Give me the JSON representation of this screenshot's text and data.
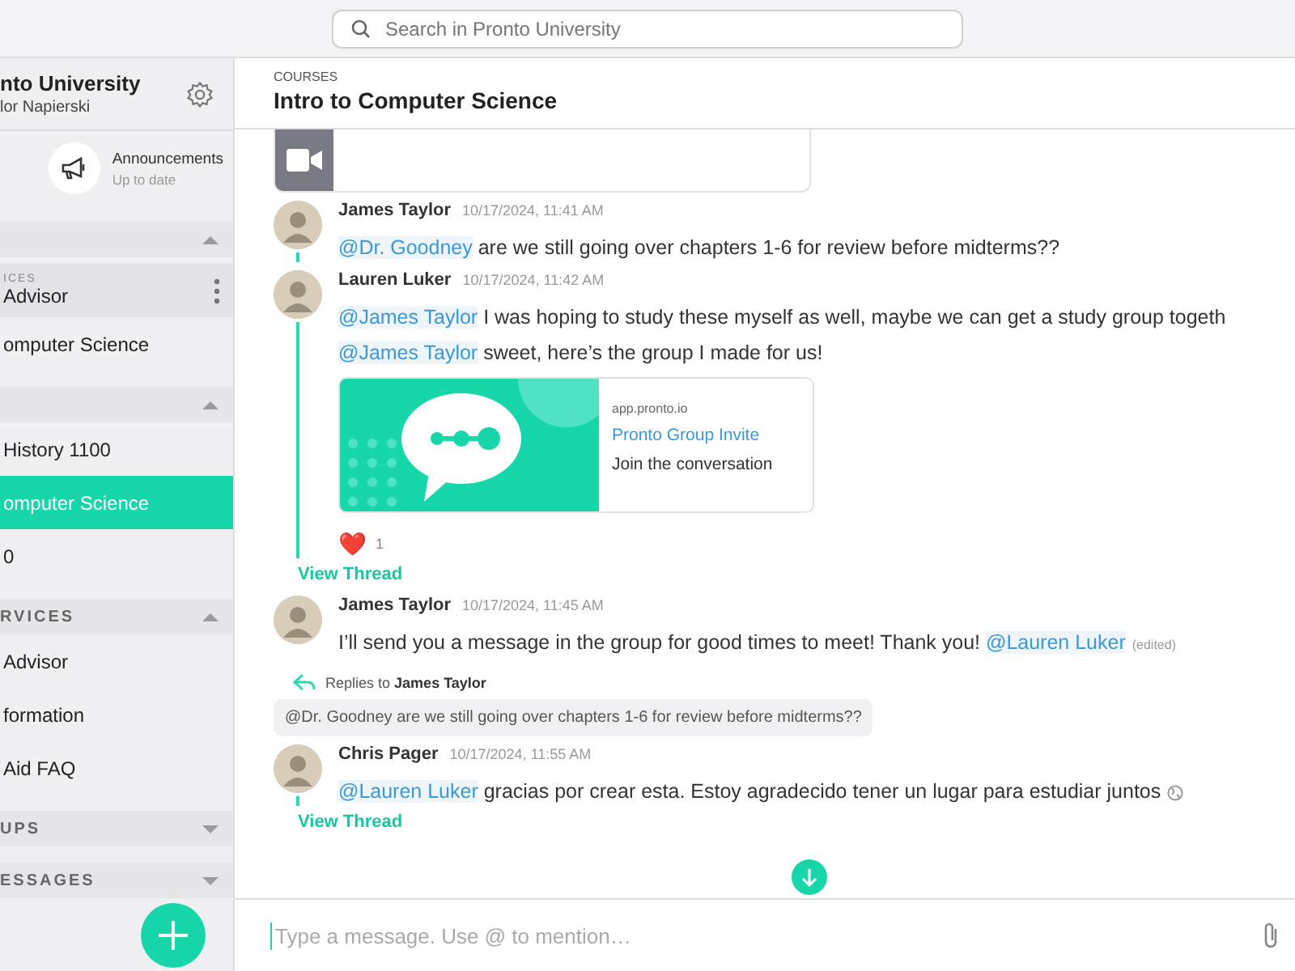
{
  "search": {
    "placeholder": "Search in Pronto University"
  },
  "sidebar": {
    "org": "nto University",
    "user": "lor Napierski",
    "announcements": {
      "title": "Announcements",
      "status": "Up to date"
    },
    "sections": [
      {
        "expanded": true,
        "items": [
          {
            "sublabel": "ICES",
            "label": "Advisor",
            "selected": false,
            "hovered": true
          },
          {
            "label": "omputer Science",
            "selected": false,
            "hovered": false
          }
        ]
      },
      {
        "expanded": true,
        "items": [
          {
            "label": "History 1100",
            "selected": false,
            "hovered": false
          },
          {
            "label": "omputer Science",
            "selected": true,
            "hovered": false
          },
          {
            "label": "0",
            "selected": false,
            "hovered": false
          }
        ]
      },
      {
        "title": "RVICES",
        "expanded": true,
        "items": [
          {
            "label": "Advisor",
            "selected": false,
            "hovered": false
          },
          {
            "label": "formation",
            "selected": false,
            "hovered": false
          },
          {
            "label": "Aid FAQ",
            "selected": false,
            "hovered": false
          }
        ]
      },
      {
        "title": "UPS",
        "expanded": false
      },
      {
        "title": "ESSAGES",
        "expanded": false
      }
    ]
  },
  "channel": {
    "category": "COURSES",
    "title": "Intro to Computer Science"
  },
  "messages": [
    {
      "kind": "message",
      "author": "James Taylor",
      "time": "10/17/2024, 11:41 AM",
      "threaded": true,
      "paragraphs": [
        [
          {
            "kind": "mention",
            "text": "@Dr. Goodney"
          },
          {
            "kind": "text",
            "text": " are we still going over chapters 1-6 for review before midterms??"
          }
        ]
      ]
    },
    {
      "kind": "message",
      "author": "Lauren Luker",
      "time": "10/17/2024, 11:42 AM",
      "threaded": true,
      "paragraphs": [
        [
          {
            "kind": "mention",
            "text": "@James Taylor"
          },
          {
            "kind": "text",
            "text": " I was hoping to study these myself as well, maybe we can get a study group togeth"
          }
        ],
        [
          {
            "kind": "mention",
            "text": "@James Taylor"
          },
          {
            "kind": "text",
            "text": " sweet, here’s the group I made for us!"
          }
        ]
      ],
      "preview": {
        "domain": "app.pronto.io",
        "title": "Pronto Group Invite",
        "description": "Join the conversation"
      },
      "reaction": {
        "emoji": "❤️",
        "count": "1"
      },
      "thread_link": "View Thread"
    },
    {
      "kind": "message",
      "author": "James Taylor",
      "time": "10/17/2024, 11:45 AM",
      "threaded": false,
      "edited": "(edited)",
      "paragraphs": [
        [
          {
            "kind": "text",
            "text": "I’ll send you a message in the group for good times to meet! Thank you! "
          },
          {
            "kind": "mention",
            "text": "@Lauren Luker"
          }
        ]
      ]
    },
    {
      "kind": "reply",
      "label": "Replies to",
      "target": "James Taylor",
      "quote": "@Dr. Goodney are we still going over chapters 1-6 for review before midterms??"
    },
    {
      "kind": "message",
      "author": "Chris Pager",
      "time": "10/17/2024, 11:55 AM",
      "threaded": true,
      "translated": true,
      "paragraphs": [
        [
          {
            "kind": "mention",
            "text": "@Lauren Luker"
          },
          {
            "kind": "text",
            "text": " gracias por crear esta. Estoy agradecido tener un lugar para estudiar juntos"
          }
        ]
      ],
      "thread_link": "View Thread"
    }
  ],
  "composer": {
    "placeholder": "Type a message. Use @ to mention…"
  }
}
